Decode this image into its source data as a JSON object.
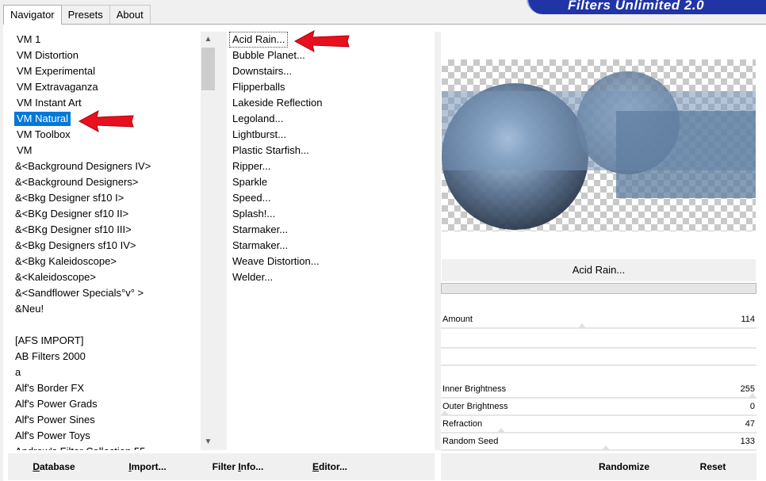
{
  "logo": {
    "text": "Filters Unlimited 2.0"
  },
  "tabs": [
    {
      "label": "Navigator",
      "active": true
    },
    {
      "label": "Presets",
      "active": false
    },
    {
      "label": "About",
      "active": false
    }
  ],
  "categories": [
    "VM 1",
    "VM Distortion",
    "VM Experimental",
    "VM Extravaganza",
    "VM Instant Art",
    "VM Natural",
    "VM Toolbox",
    "VM",
    "&<Background Designers IV>",
    "&<Background Designers>",
    "&<Bkg Designer sf10 I>",
    "&<BKg Designer sf10 II>",
    "&<BKg Designer sf10 III>",
    "&<Bkg Designers sf10 IV>",
    "&<Bkg Kaleidoscope>",
    "&<Kaleidoscope>",
    "&<Sandflower Specials°v° >",
    "&Neu!",
    "",
    "[AFS IMPORT]",
    "AB Filters 2000",
    "a",
    "Alf's Border FX",
    "Alf's Power Grads",
    "Alf's Power Sines",
    "Alf's Power Toys",
    "Andrew's Filter Collection 55"
  ],
  "selected_category": "VM Natural",
  "filters": [
    "Acid Rain...",
    "Bubble Planet...",
    "Downstairs...",
    "Flipperballs",
    "Lakeside Reflection",
    "Legoland...",
    "Lightburst...",
    "Plastic Starfish...",
    "Ripper...",
    "Sparkle",
    "Speed...",
    "Splash!...",
    "Starmaker...",
    "Starmaker...",
    "Weave Distortion...",
    "Welder..."
  ],
  "selected_filter": "Acid Rain...",
  "filter_name": "Acid Rain...",
  "params": [
    {
      "label": "Amount",
      "value": "114",
      "fraction": 0.447
    },
    {
      "label": "Inner Brightness",
      "value": "255",
      "fraction": 1.0
    },
    {
      "label": "Outer Brightness",
      "value": "0",
      "fraction": 0.0
    },
    {
      "label": "Refraction",
      "value": "47",
      "fraction": 0.184
    },
    {
      "label": "Random Seed",
      "value": "133",
      "fraction": 0.522
    }
  ],
  "buttons": {
    "database": "Database",
    "import": "Import...",
    "filter_info": "Filter Info...",
    "editor": "Editor...",
    "randomize": "Randomize",
    "reset": "Reset"
  },
  "icons": {
    "scroll_up": "chevron-up-icon",
    "scroll_down": "chevron-down-icon",
    "arrow": "red-arrow-icon"
  },
  "colors": {
    "selection": "#0078d7",
    "logo_bg": "#2134a6",
    "arrow": "#e8101e"
  }
}
